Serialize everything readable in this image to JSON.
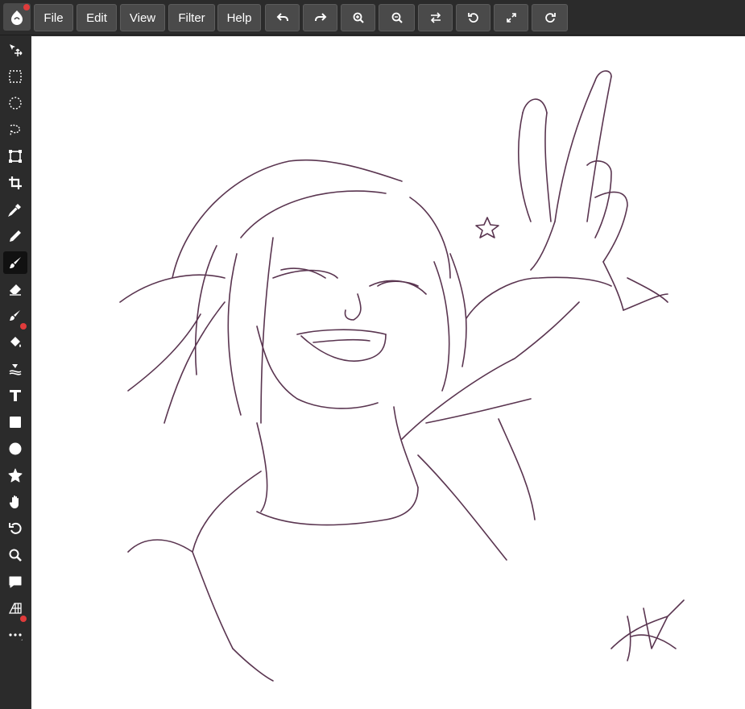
{
  "app": {
    "accent_color": "#e03b3b",
    "logo_icon": "app-logo-icon"
  },
  "menu": {
    "file": "File",
    "edit": "Edit",
    "view": "View",
    "filter": "Filter",
    "help": "Help"
  },
  "toolbar_actions": [
    "undo-icon",
    "redo-icon",
    "zoom-in-icon",
    "zoom-out-icon",
    "swap-icon",
    "reset-icon",
    "fullscreen-icon",
    "redo-rotate-icon"
  ],
  "tools": [
    "move-tool",
    "rect-select-tool",
    "ellipse-select-tool",
    "lasso-select-tool",
    "transform-tool",
    "crop-tool",
    "eyedropper-tool",
    "pen-tool",
    "brush-tool",
    "eraser-tool",
    "smudge-tool",
    "fill-tool",
    "blend-tool",
    "text-tool",
    "rectangle-shape-tool",
    "ellipse-shape-tool",
    "star-shape-tool",
    "hand-tool",
    "rotate-tool",
    "zoom-tool",
    "comment-tool",
    "perspective-grid-tool",
    "more-tools"
  ],
  "active_tool": "brush-tool",
  "canvas": {
    "background": "#ffffff",
    "stroke_color": "#5a3550",
    "content": "sketch-drawing"
  }
}
